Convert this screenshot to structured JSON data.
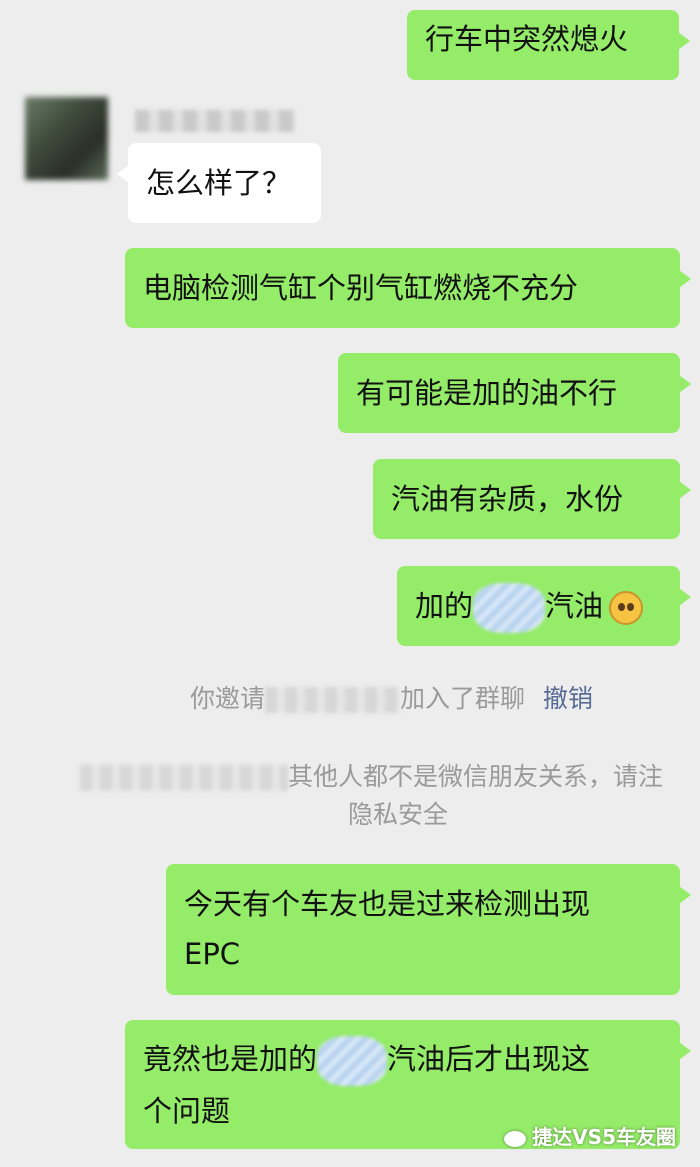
{
  "messages": [
    {
      "text": "行车中突然熄火"
    },
    {
      "text": "怎么样了？"
    },
    {
      "text": "电脑检测气缸个别气缸燃烧不充分"
    },
    {
      "text": "有可能是加的油不行"
    },
    {
      "text": "汽油有杂质，水份"
    },
    {
      "before": "加的",
      "after": "汽油"
    },
    {
      "line1": "今天有个车友也是过来检测出现",
      "line2": "EPC"
    },
    {
      "line1_before": "竟然也是加的",
      "line1_after": "汽油后才出现这",
      "line2": "个问题"
    }
  ],
  "system": {
    "invite_prefix": "你邀请",
    "invite_suffix": "加入了群聊",
    "revoke": "撤销",
    "privacy_line1": "其他人都不是微信朋友关系，请注",
    "privacy_line2": "隐私安全"
  },
  "watermark": "捷达VS5车友圈",
  "colors": {
    "sent_bubble": "#95ec69",
    "received_bubble": "#ffffff",
    "background": "#ededed",
    "link": "#576b95"
  },
  "icons": {
    "emoji": "pleading-face-emoji",
    "watermark": "wechat-icon"
  }
}
